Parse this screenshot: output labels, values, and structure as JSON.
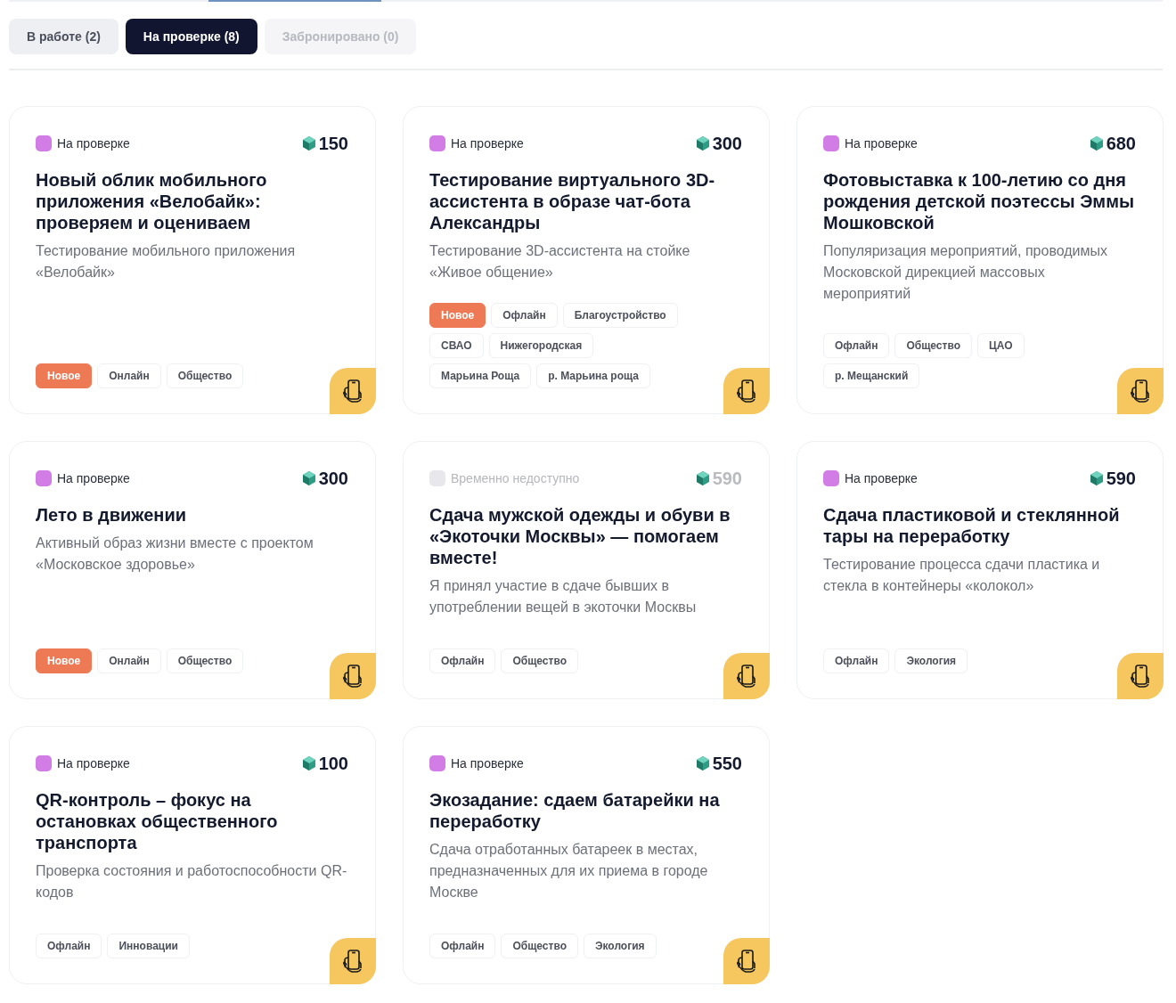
{
  "tabs": [
    {
      "label": "В работе (2)",
      "selected": false,
      "disabled": false
    },
    {
      "label": "На проверке (8)",
      "selected": true,
      "disabled": false
    },
    {
      "label": "Забронировано (0)",
      "selected": false,
      "disabled": true
    }
  ],
  "cards": [
    {
      "status": "На проверке",
      "color": "#d27ce6",
      "disabled": false,
      "points": "150",
      "title": "Новый облик мобильного приложения «Велобайк»: проверяем и оцениваем",
      "description": "Тестирование мобильного приложения «Велобайк»",
      "tags": [
        {
          "label": "Новое",
          "kind": "new"
        },
        {
          "label": "Онлайн",
          "kind": "plain"
        },
        {
          "label": "Общество",
          "kind": "plain"
        }
      ]
    },
    {
      "status": "На проверке",
      "color": "#d27ce6",
      "disabled": false,
      "points": "300",
      "title": "Тестирование виртуального 3D-ассистента в образе чат-бота Александры",
      "description": "Тестирование 3D-ассистента на стойке «Живое общение»",
      "tags": [
        {
          "label": "Новое",
          "kind": "new"
        },
        {
          "label": "Офлайн",
          "kind": "plain"
        },
        {
          "label": "Благоустройство",
          "kind": "plain"
        },
        {
          "label": "СВАО",
          "kind": "plain"
        },
        {
          "label": "Нижегородская",
          "kind": "plain"
        },
        {
          "label": "Марьина Роща",
          "kind": "plain"
        },
        {
          "label": "р. Марьина роща",
          "kind": "plain"
        }
      ]
    },
    {
      "status": "На проверке",
      "color": "#d27ce6",
      "disabled": false,
      "points": "680",
      "title": "Фотовыставка к 100-летию со дня рождения детской поэтессы Эммы Мошковской",
      "description": "Популяризация мероприятий, проводимых Московской дирекцией массовых мероприятий",
      "tags": [
        {
          "label": "Офлайн",
          "kind": "plain"
        },
        {
          "label": "Общество",
          "kind": "plain"
        },
        {
          "label": "ЦАО",
          "kind": "plain"
        },
        {
          "label": "р. Мещанский",
          "kind": "plain"
        }
      ]
    },
    {
      "status": "На проверке",
      "color": "#d27ce6",
      "disabled": false,
      "points": "300",
      "title": "Лето в движении",
      "description": "Активный образ жизни вместе с проектом «Московское здоровье»",
      "tags": [
        {
          "label": "Новое",
          "kind": "new"
        },
        {
          "label": "Онлайн",
          "kind": "plain"
        },
        {
          "label": "Общество",
          "kind": "plain"
        }
      ]
    },
    {
      "status": "Временно недоступно",
      "color": "#e8e8ec",
      "disabled": true,
      "points": "590",
      "title": "Сдача мужской одежды и обуви в «Экоточки Москвы» — помогаем вместе!",
      "description": "Я принял участие в сдаче бывших в употреблении вещей в экоточки Москвы",
      "tags": [
        {
          "label": "Офлайн",
          "kind": "plain"
        },
        {
          "label": "Общество",
          "kind": "plain"
        }
      ]
    },
    {
      "status": "На проверке",
      "color": "#d27ce6",
      "disabled": false,
      "points": "590",
      "title": "Сдача пластиковой и стеклянной тары на переработку",
      "description": "Тестирование процесса сдачи пластика и стекла в контейнеры «колокол»",
      "tags": [
        {
          "label": "Офлайн",
          "kind": "plain"
        },
        {
          "label": "Экология",
          "kind": "plain"
        }
      ]
    },
    {
      "status": "На проверке",
      "color": "#d27ce6",
      "disabled": false,
      "points": "100",
      "title": "QR-контроль – фокус на остановках общественного транспорта",
      "description": "Проверка состояния и работоспособности QR-кодов",
      "tags": [
        {
          "label": "Офлайн",
          "kind": "plain"
        },
        {
          "label": "Инновации",
          "kind": "plain"
        }
      ]
    },
    {
      "status": "На проверке",
      "color": "#d27ce6",
      "disabled": false,
      "points": "550",
      "title": "Экозадание: сдаем батарейки на переработку",
      "description": "Сдача отработанных батареек в местах, предназначенных для их приема в городе Москве",
      "tags": [
        {
          "label": "Офлайн",
          "kind": "plain"
        },
        {
          "label": "Общество",
          "kind": "plain"
        },
        {
          "label": "Экология",
          "kind": "plain"
        }
      ]
    }
  ]
}
